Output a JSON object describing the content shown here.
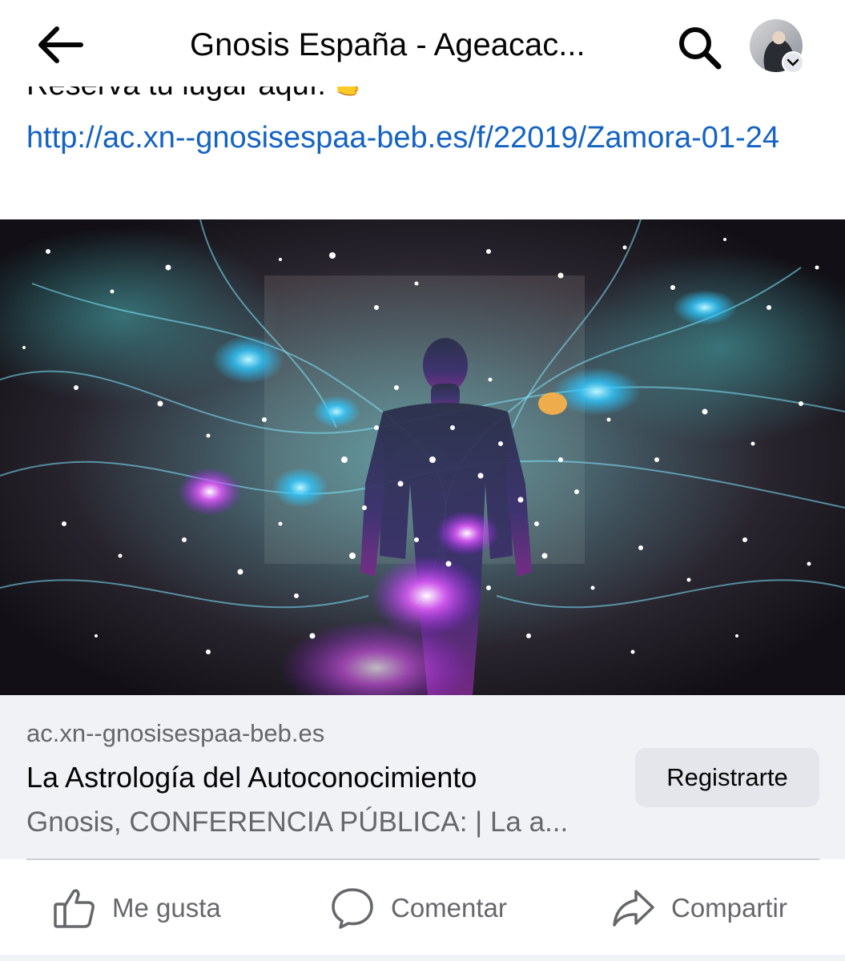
{
  "header": {
    "title": "Gnosis España - Ageacac...",
    "back_icon": "arrow-left-icon",
    "search_icon": "search-icon"
  },
  "post": {
    "text_line": "Reserva tu lugar aquí: 👉",
    "link": "http://ac.xn--gnosisespaa-beb.es/f/22019/Zamora-01-24"
  },
  "link_card": {
    "domain": "ac.xn--gnosisespaa-beb.es",
    "title": "La Astrología del Autoconocimiento",
    "description": "Gnosis, CONFERENCIA PÚBLICA: | La a...",
    "cta_label": "Registrarte"
  },
  "actions": {
    "like": "Me gusta",
    "comment": "Comentar",
    "share": "Compartir"
  },
  "colors": {
    "link": "#1463c4",
    "secondary_text": "#65676b",
    "card_bg": "#f0f2f5",
    "button_bg": "#e4e6eb"
  }
}
